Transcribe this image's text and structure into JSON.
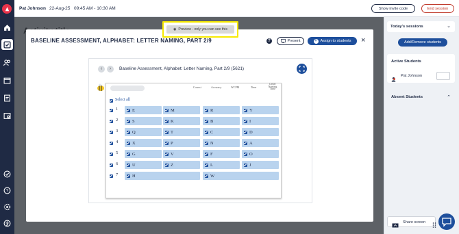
{
  "topbar": {
    "user_name": "Pat Johnson",
    "date": "22-Aug-25",
    "time_range": "09:45 AM - 10:30 AM",
    "show_invite_label": "Show invite code",
    "end_session_label": "End session"
  },
  "background": {
    "partial_title": "Activity title"
  },
  "preview_banner": {
    "text": "Preview - only you can see this"
  },
  "modal": {
    "title": "BASELINE ASSESSMENT, ALPHABET: LETTER NAMING, PART 2/9",
    "present_label": "Present",
    "assign_label": "Assign to students",
    "inner_title": "Baseline Assessment, Alphabet: Letter Naming, Part 2/9 (5621)",
    "column_headers": [
      "Correct",
      "Accuracy",
      "WCPM",
      "Time",
      "Letter Naming Time"
    ],
    "select_all_label": "Select all",
    "rows": [
      {
        "num": "1",
        "letters": [
          "E",
          "M",
          "R",
          "Y"
        ]
      },
      {
        "num": "2",
        "letters": [
          "S",
          "K",
          "B",
          "I"
        ]
      },
      {
        "num": "3",
        "letters": [
          "Q",
          "T",
          "C",
          "D"
        ]
      },
      {
        "num": "4",
        "letters": [
          "X",
          "P",
          "N",
          "A"
        ]
      },
      {
        "num": "5",
        "letters": [
          "G",
          "V",
          "F",
          "O"
        ]
      },
      {
        "num": "6",
        "letters": [
          "U",
          "Z",
          "L",
          "J"
        ]
      },
      {
        "num": "7",
        "letters": [
          "H",
          "W"
        ]
      }
    ]
  },
  "right_panel": {
    "todays_sessions": "Today's sessions",
    "add_remove_label": "Add/Remove students",
    "active_students": "Active Students",
    "student_name": "Pat Johnson",
    "absent_students": "Absent Students",
    "share_screen_label": "Share screen"
  },
  "colors": {
    "nav": "#1f2a44",
    "accent_blue": "#1e4f9c",
    "cell_blue": "#b9d3ee",
    "highlight_yellow": "#f7ea00",
    "end_red": "#c0392b"
  }
}
